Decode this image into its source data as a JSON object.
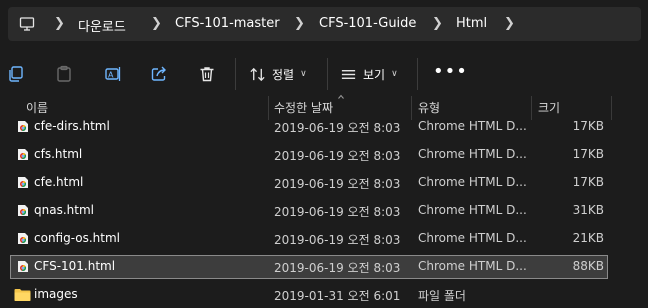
{
  "breadcrumb": [
    "다운로드",
    "CFS-101-master",
    "CFS-101-Guide",
    "Html"
  ],
  "toolbar": {
    "sort_label": "정렬",
    "view_label": "보기",
    "more_label": "•••"
  },
  "columns": {
    "name": "이름",
    "date": "수정한 날짜",
    "type": "유형",
    "size": "크기"
  },
  "rows": [
    {
      "name": "cfe-dirs.html",
      "date": "2019-06-19 오전 8:03",
      "type": "Chrome HTML D...",
      "size": "17KB",
      "icon": "chrome-html-icon"
    },
    {
      "name": "cfs.html",
      "date": "2019-06-19 오전 8:03",
      "type": "Chrome HTML D...",
      "size": "17KB",
      "icon": "chrome-html-icon"
    },
    {
      "name": "cfe.html",
      "date": "2019-06-19 오전 8:03",
      "type": "Chrome HTML D...",
      "size": "17KB",
      "icon": "chrome-html-icon"
    },
    {
      "name": "qnas.html",
      "date": "2019-06-19 오전 8:03",
      "type": "Chrome HTML D...",
      "size": "31KB",
      "icon": "chrome-html-icon"
    },
    {
      "name": "config-os.html",
      "date": "2019-06-19 오전 8:03",
      "type": "Chrome HTML D...",
      "size": "21KB",
      "icon": "chrome-html-icon"
    },
    {
      "name": "CFS-101.html",
      "date": "2019-06-19 오전 8:03",
      "type": "Chrome HTML D...",
      "size": "88KB",
      "icon": "chrome-html-icon",
      "selected": true
    },
    {
      "name": "images",
      "date": "2019-01-31 오전 6:01",
      "type": "파일 폴더",
      "size": "",
      "icon": "folder-icon"
    }
  ],
  "colors": {
    "background": "#1c1c1c",
    "bar": "#2b2b2b",
    "selection": "#3d3d3d",
    "folder": "#f4c54a",
    "icon_blue": "#6fb6ff"
  }
}
